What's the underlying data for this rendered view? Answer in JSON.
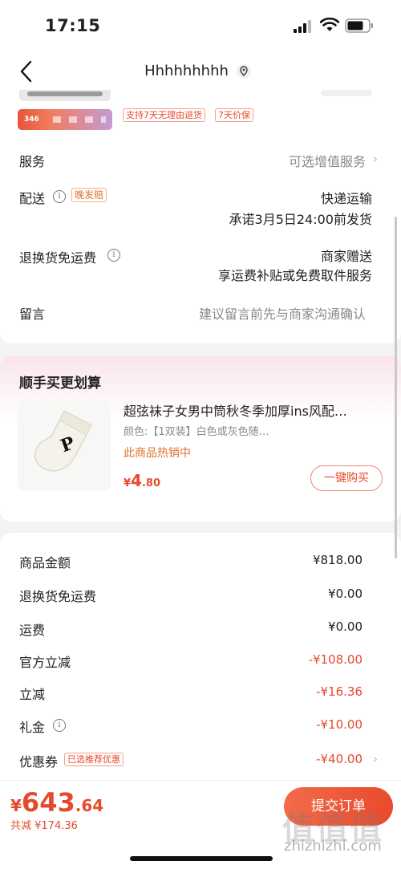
{
  "status_bar": {
    "time": "17:15"
  },
  "nav": {
    "title": "Hhhhhhhhh"
  },
  "product_summary": {
    "promo_price": "346",
    "tags": [
      "支持7天无理由退货",
      "7天价保"
    ]
  },
  "service": {
    "label": "服务",
    "value": "可选增值服务"
  },
  "delivery": {
    "label": "配送",
    "late_tag": "晚发赔",
    "method": "快递运输",
    "promise": "承诺3月5日24:00前发货"
  },
  "return_shipping": {
    "label": "退换货免运费",
    "value": "商家赠送",
    "desc": "享运费补贴或免费取件服务"
  },
  "message": {
    "label": "留言",
    "placeholder": "建议留言前先与商家沟通确认"
  },
  "addon": {
    "section_title": "顺手买更划算",
    "product_title": "超弦袜子女男中筒秋冬季加厚ins风配…",
    "spec": "颜色:【1双装】白色或灰色随…",
    "hot": "此商品热销中",
    "price_symbol": "¥",
    "price_int": "4",
    "price_dec": ".80",
    "buy_button": "一键购买"
  },
  "amounts": [
    {
      "label": "商品金额",
      "value": "¥818.00",
      "red": false
    },
    {
      "label": "退换货免运费",
      "value": "¥0.00",
      "red": false
    },
    {
      "label": "运费",
      "value": "¥0.00",
      "red": false
    },
    {
      "label": "官方立减",
      "value": "-¥108.00",
      "red": true
    },
    {
      "label": "立减",
      "value": "-¥16.36",
      "red": true
    },
    {
      "label": "礼金",
      "value": "-¥10.00",
      "red": true
    },
    {
      "label": "优惠券",
      "value": "-¥40.00",
      "red": true
    }
  ],
  "coupon_tag": "已选推荐优惠",
  "footer": {
    "currency": "¥",
    "total_int": "643",
    "total_dec": ".64",
    "saved": "共减 ¥174.36",
    "submit": "提交订单"
  },
  "watermark": {
    "logo": "值值值",
    "text": "zhizhizhi.com"
  },
  "colors": {
    "accent_red": "#e64a2e",
    "orange": "#e0702e",
    "pink_bg": "#fbe4ef"
  },
  "icons": [
    "signal-icon",
    "wifi-icon",
    "battery-icon",
    "back-arrow-icon",
    "location-icon",
    "info-icon",
    "chevron-right-icon"
  ]
}
